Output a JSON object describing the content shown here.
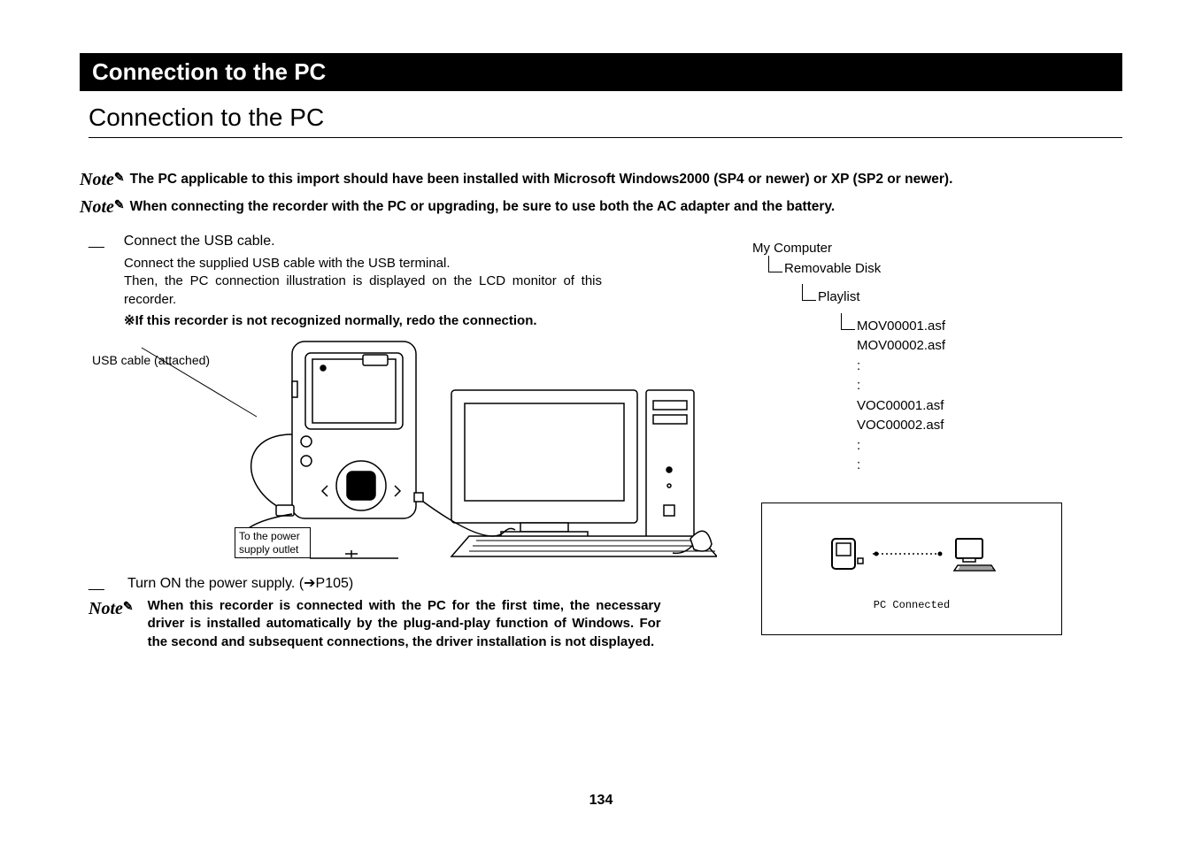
{
  "title_bar": "Connection to the PC",
  "subtitle": "Connection to the PC",
  "note_icon_text": "Note",
  "note1": "The PC applicable to this import should have been installed with Microsoft Windows2000 (SP4 or newer) or XP (SP2 or newer).",
  "note2": "When connecting the recorder with the PC or upgrading, be sure to use both the AC adapter and the battery.",
  "step1_title": "Connect the USB cable.",
  "step1_body": "Connect the supplied USB cable with the USB terminal.\nThen, the PC connection illustration is displayed on the LCD monitor of this recorder.",
  "step1_warn": "※If this recorder is not recognized normally, redo the connection.",
  "usb_cable_label": "USB cable (attached)",
  "power_outlet_label": "To the power supply outlet",
  "tree": {
    "root": "My Computer",
    "l1": "Removable Disk",
    "l2": "Playlist",
    "files": [
      "MOV00001.asf",
      "MOV00002.asf",
      ":",
      ":",
      "VOC00001.asf",
      "VOC00002.asf",
      ":",
      ":"
    ]
  },
  "step2_title": "Turn ON the power supply. (➔P105)",
  "note3": "When this recorder is connected with the PC for the first time, the necessary driver is installed automatically by the plug-and-play function of Windows. For the second and subsequent connections, the driver installation is not displayed.",
  "pc_connected": "PC Connected",
  "page_number": "134"
}
